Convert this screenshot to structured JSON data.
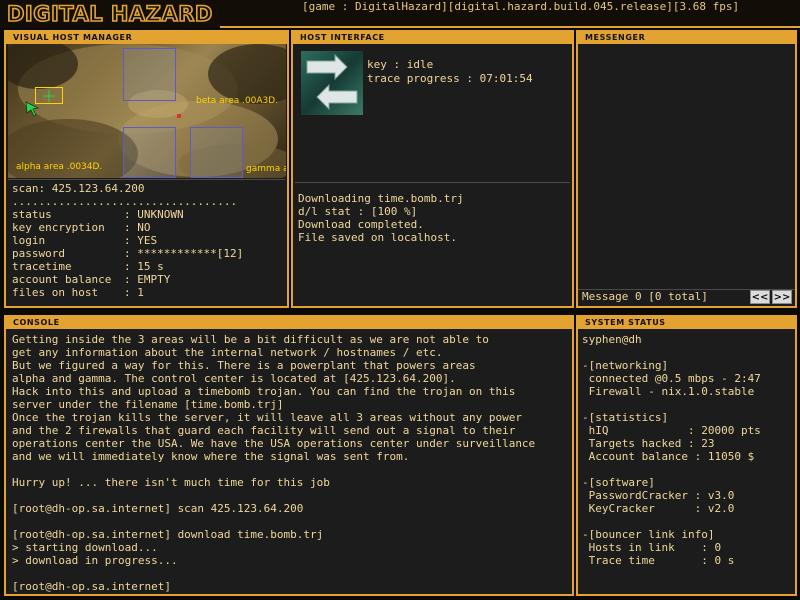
{
  "header": {
    "logo_text": "DIGITAL HAZARD",
    "game_info": "[game : DigitalHazard][digital.hazard.build.045.release][3.68 fps]"
  },
  "visual_host_manager": {
    "title": "VISUAL HOST MANAGER",
    "map_labels": {
      "beta": "beta area .00A3D.",
      "alpha": "alpha area .0034D.",
      "gamma": "gamma a"
    },
    "scan_line": "scan: 425.123.64.200",
    "separator": "..................................",
    "fields": [
      {
        "label": "status        ",
        "value": ": UNKNOWN"
      },
      {
        "label": "key encryption",
        "value": ": NO"
      },
      {
        "label": "login         ",
        "value": ": YES"
      },
      {
        "label": "password      ",
        "value": ": ************[12]"
      },
      {
        "label": "tracetime     ",
        "value": ": 15 s"
      },
      {
        "label": "account balance",
        "value": ": EMPTY"
      },
      {
        "label": "files on host ",
        "value": ": 1"
      }
    ]
  },
  "host_interface": {
    "title": "HOST INTERFACE",
    "key_line": "key : idle",
    "trace_line": "trace progress : 07:01:54",
    "log": [
      "Downloading time.bomb.trj",
      "d/l stat : [100 %]",
      "Download completed.",
      "File saved on localhost."
    ]
  },
  "messenger": {
    "title": "MESSENGER",
    "status": "Message 0 [0 total]",
    "prev_label": "<<",
    "next_label": ">>"
  },
  "console": {
    "title": "CONSOLE",
    "lines": [
      "Getting inside the 3 areas will be a bit difficult as we are not able to",
      "get any information about the internal network / hostnames / etc.",
      "But we figured a way for this. There is a powerplant that powers areas",
      "alpha and gamma. The control center is located at [425.123.64.200].",
      "Hack into this and upload a timebomb trojan. You can find the trojan on this",
      "server under the filename [time.bomb.trj]",
      "Once the trojan kills the server, it will leave all 3 areas without any power",
      "and the 2 firewalls that guard each facility will send out a signal to their",
      "operations center the USA. We have the USA operations center under surveillance",
      "and we will immediately know where the signal was sent from.",
      "",
      "Hurry up! ... there isn't much time for this job",
      "",
      "[root@dh-op.sa.internet] scan 425.123.64.200",
      "",
      "[root@dh-op.sa.internet] download time.bomb.trj",
      "> starting download...",
      "> download in progress...",
      "",
      "[root@dh-op.sa.internet]"
    ]
  },
  "system_status": {
    "title": "SYSTEM STATUS",
    "lines": [
      "syphen@dh",
      "",
      "-[networking]",
      " connected @0.5 mbps - 2:47",
      " Firewall - nix.1.0.stable",
      "",
      "-[statistics]",
      " hIQ            : 20000 pts",
      " Targets hacked : 23",
      " Account balance : 11050 $",
      "",
      "-[software]",
      " PasswordCracker : v3.0",
      " KeyCracker      : v2.0",
      "",
      "-[bouncer link info]",
      " Hosts in link    : 0",
      " Trace time       : 0 s"
    ]
  },
  "colors": {
    "accent": "#e3a330",
    "panel_bg": "#1c1c1c",
    "text": "#f1d79b",
    "map_label": "#ffd400",
    "area_box": "#5b5cc9",
    "cursor_green": "#2fd24a"
  }
}
